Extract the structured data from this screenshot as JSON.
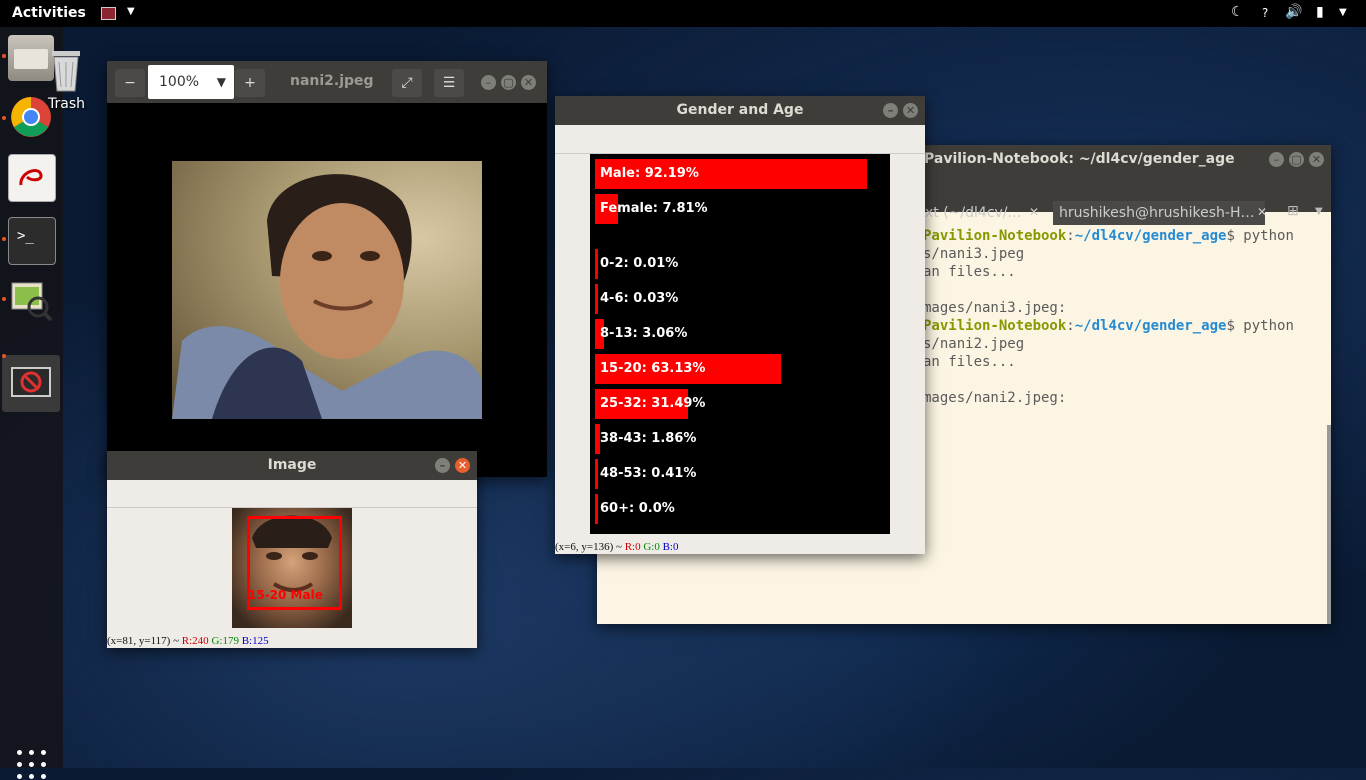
{
  "topbar": {
    "activities": "Activities",
    "icons": [
      "keyboard-flag-icon",
      "night-light-icon",
      "help-icon",
      "volume-icon",
      "battery-icon",
      "menu-arrow-icon"
    ]
  },
  "desktop": {
    "trash_label": "Trash"
  },
  "dock": {
    "items": [
      "files-icon",
      "chrome-icon",
      "document-viewer-icon",
      "terminal-icon",
      "image-viewer-icon",
      "opencv-window-icon"
    ],
    "show_apps": "show-applications-icon"
  },
  "image_viewer": {
    "zoom": "100%",
    "title": "nani2.jpeg"
  },
  "image_window": {
    "title": "Image",
    "face_label": "15-20 Male",
    "status": {
      "coords": "(x=81, y=117) ~",
      "r": "R:240",
      "g": "G:179",
      "b": "B:125"
    }
  },
  "gender_age_window": {
    "title": "Gender and Age",
    "status": {
      "coords": "(x=6, y=136) ~",
      "r": "R:0",
      "g": "G:0",
      "b": "B:0"
    },
    "bars": [
      {
        "label": "Male: 92.19%",
        "value": 92.19
      },
      {
        "label": "Female: 7.81%",
        "value": 7.81
      },
      {
        "label": "0-2: 0.01%",
        "value": 0.01
      },
      {
        "label": "4-6: 0.03%",
        "value": 0.03
      },
      {
        "label": "8-13: 3.06%",
        "value": 3.06
      },
      {
        "label": "15-20: 63.13%",
        "value": 63.13
      },
      {
        "label": "25-32: 31.49%",
        "value": 31.49
      },
      {
        "label": "38-43: 1.86%",
        "value": 1.86
      },
      {
        "label": "48-53: 0.41%",
        "value": 0.41
      },
      {
        "label": "60+: 0.0%",
        "value": 0.0
      }
    ]
  },
  "terminal": {
    "title": "Pavilion-Notebook: ~/dl4cv/gender_age",
    "tabs": [
      "xt (~/dl4cv/…",
      "hrushikesh@hrushikesh-H…"
    ],
    "lines": [
      {
        "host": "Pavilion-Notebook",
        "path": "~/dl4cv/gender_age",
        "cmd": "$ python"
      },
      {
        "text": "s/nani3.jpeg"
      },
      {
        "text": "an files..."
      },
      {
        "text": ""
      },
      {
        "text": "mages/nani3.jpeg:"
      },
      {
        "host": "Pavilion-Notebook",
        "path": "~/dl4cv/gender_age",
        "cmd": "$ python"
      },
      {
        "text": "s/nani2.jpeg"
      },
      {
        "text": "an files..."
      },
      {
        "text": ""
      },
      {
        "text": "mages/nani2.jpeg:"
      }
    ]
  }
}
